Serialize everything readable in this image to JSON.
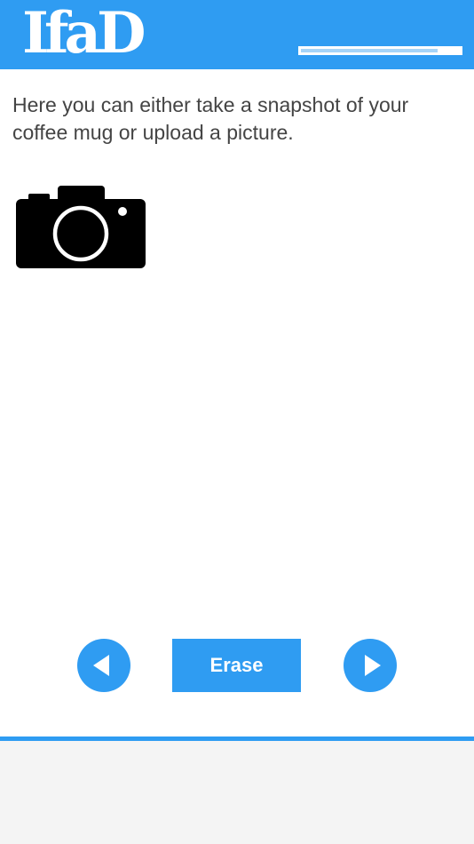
{
  "header": {
    "logo_text": "IfaD",
    "progress_fraction": 0.86,
    "background_color": "#2f9cf2"
  },
  "main": {
    "instructions": "Here you can either take a snapshot of your coffee mug or upload a picture.",
    "camera_icon": "camera-icon"
  },
  "controls": {
    "back_icon": "arrow-left-icon",
    "erase_label": "Erase",
    "next_icon": "arrow-right-icon",
    "accent_color": "#2f9cf2"
  },
  "footer": {
    "background_color": "#f4f4f4"
  }
}
